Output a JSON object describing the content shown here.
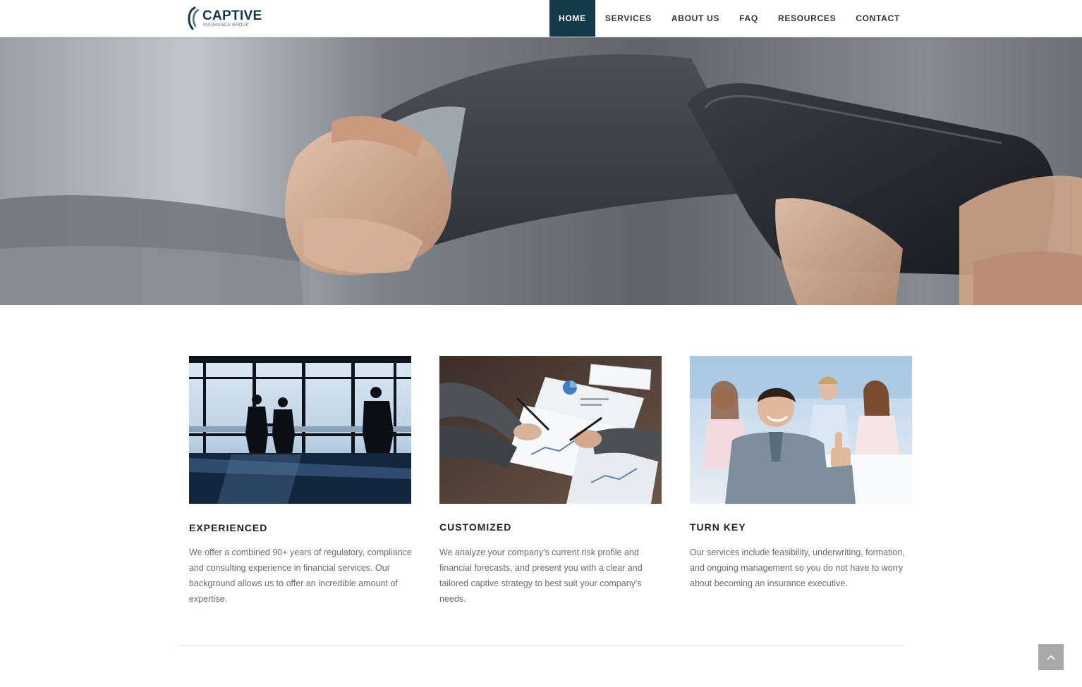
{
  "logo": {
    "title": "CAPTIVE",
    "subtitle": "INSURANCE GROUP"
  },
  "nav": {
    "items": [
      {
        "label": "HOME",
        "active": true
      },
      {
        "label": "SERVICES",
        "active": false
      },
      {
        "label": "ABOUT US",
        "active": false
      },
      {
        "label": "FAQ",
        "active": false
      },
      {
        "label": "RESOURCES",
        "active": false
      },
      {
        "label": "CONTACT",
        "active": false
      }
    ]
  },
  "hero": {
    "image": "handshake-photo"
  },
  "features": [
    {
      "image": "silhouette-meeting-photo",
      "title": "EXPERIENCED",
      "text_lines": [
        "We offer a combined 90+ years of regulatory, compliance",
        "and consulting experience in financial services. Our",
        "background allows us to offer an incredible amount of",
        "expertise."
      ]
    },
    {
      "image": "document-review-photo",
      "title": "CUSTOMIZED",
      "text_lines": [
        "We analyze your company's current risk profile and",
        "financial forecasts, and present you with a clear and",
        "tailored captive strategy to best suit your company's",
        "needs."
      ]
    },
    {
      "image": "team-thumbs-up-photo",
      "title": "TURN KEY",
      "text_lines": [
        "Our services include feasibility, underwriting, formation,",
        "and ongoing management so you do not have to worry",
        "about becoming an insurance executive."
      ]
    }
  ],
  "colors": {
    "brand": "#123a48",
    "nav_active_bg": "#123a48",
    "body_text": "#6b6b6b",
    "back_to_top_bg": "#a9a9a9"
  },
  "back_to_top": {
    "icon": "chevron-up-icon"
  }
}
